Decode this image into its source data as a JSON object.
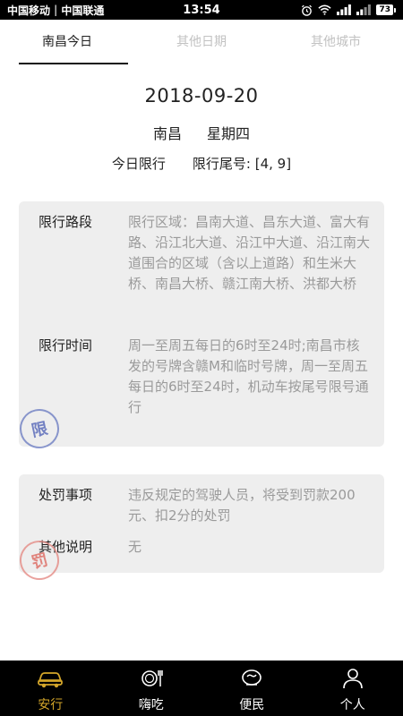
{
  "status_bar": {
    "carrier_1": "中国移动",
    "separator": "|",
    "carrier_2": "中国联通",
    "time": "13:54",
    "battery_level": "73",
    "icons": [
      "alarm-icon",
      "wifi-icon",
      "signal-icon",
      "battery-icon"
    ]
  },
  "tabs": [
    {
      "label": "南昌今日",
      "active": true
    },
    {
      "label": "其他日期",
      "active": false
    },
    {
      "label": "其他城市",
      "active": false
    }
  ],
  "header": {
    "date": "2018-09-20",
    "city": "南昌",
    "weekday": "星期四",
    "today_limit_label": "今日限行",
    "tail_number_label": "限行尾号: [4, 9]"
  },
  "info_card": {
    "route_label": "限行路段",
    "route_value": "限行区域：昌南大道、昌东大道、富大有路、沿江北大道、沿江中大道、沿江南大道围合的区域（含以上道路）和生米大桥、南昌大桥、赣江南大桥、洪都大桥",
    "time_label": "限行时间",
    "time_value": "周一至周五每日的6时至24时;南昌市核发的号牌含赣M和临时号牌，周一至周五每日的6时至24时，机动车按尾号限号通行",
    "stamp": "限"
  },
  "penalty_card": {
    "penalty_label": "处罚事项",
    "penalty_value": "违反规定的驾驶人员，将受到罚款200元、扣2分的处罚",
    "notes_label": "其他说明",
    "notes_value": "无",
    "stamp": "罚"
  },
  "bottom_nav": [
    {
      "label": "安行",
      "icon": "car-icon",
      "active": true
    },
    {
      "label": "嗨吃",
      "icon": "dining-icon",
      "active": false
    },
    {
      "label": "便民",
      "icon": "service-icon",
      "active": false
    },
    {
      "label": "个人",
      "icon": "person-icon",
      "active": false
    }
  ],
  "colors": {
    "accent": "#d4a62a",
    "card_bg": "#eeeeee",
    "text_muted": "#9a9a9a",
    "tab_inactive": "#c2c2c2"
  }
}
